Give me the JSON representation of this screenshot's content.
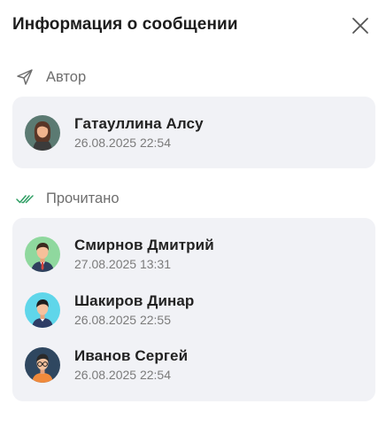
{
  "dialog": {
    "title": "Информация о сообщении",
    "close_icon": "close-icon"
  },
  "author_section": {
    "label": "Автор",
    "icon": "send-icon",
    "person": {
      "name": "Гатауллина Алсу",
      "date": "26.08.2025 22:54",
      "avatar": "avatar-woman"
    }
  },
  "read_section": {
    "label": "Прочитано",
    "icon": "double-check-icon",
    "icon_color": "#2e9e63",
    "people": [
      {
        "name": "Смирнов Дмитрий",
        "date": "27.08.2025 13:31",
        "avatar": "avatar-man-tie"
      },
      {
        "name": "Шакиров Динар",
        "date": "26.08.2025 22:55",
        "avatar": "avatar-man-cyan"
      },
      {
        "name": "Иванов Сергей",
        "date": "26.08.2025 22:54",
        "avatar": "avatar-man-glasses"
      }
    ]
  }
}
